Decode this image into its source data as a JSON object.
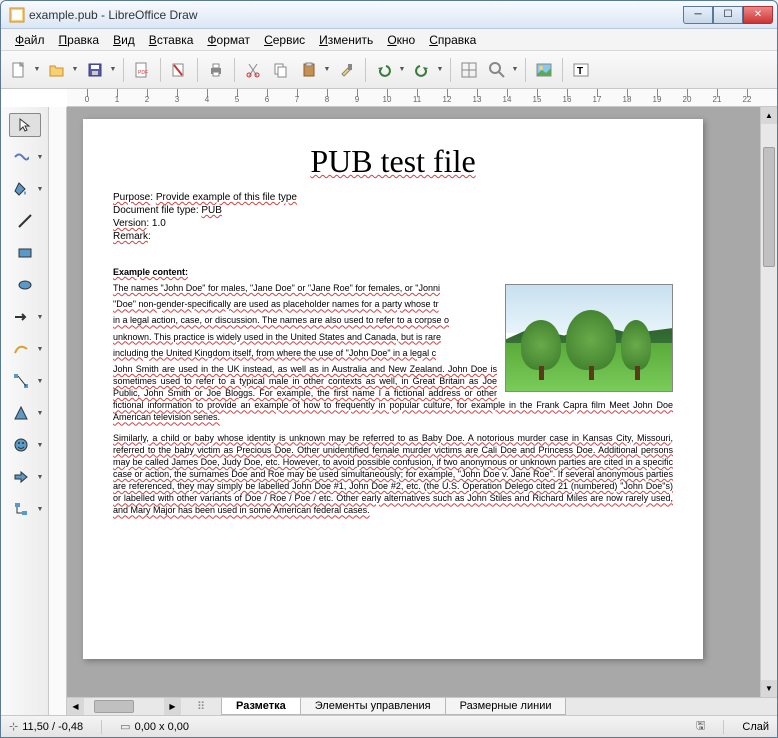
{
  "window": {
    "title": "example.pub - LibreOffice Draw"
  },
  "menu": [
    "Файл",
    "Правка",
    "Вид",
    "Вставка",
    "Формат",
    "Сервис",
    "Изменить",
    "Окно",
    "Справка"
  ],
  "tabs": {
    "active": "Разметка",
    "items": [
      "Разметка",
      "Элементы управления",
      "Размерные линии"
    ]
  },
  "statusbar": {
    "position": "11,50 / -0,48",
    "size": "0,00 x 0,00",
    "mode": "Слай"
  },
  "document": {
    "title": "PUB test file",
    "meta": {
      "purpose_label": "Purpose",
      "purpose": "Provide example of this file type",
      "doctype_label": "Document file type",
      "doctype": "PUB",
      "version_label": "Version",
      "version": "1.0",
      "remark_label": "Remark",
      "remark": ""
    },
    "content_heading": "Example content:",
    "para1": "The names \"John Doe\" for males, \"Jane Doe\" or \"Jane Roe\" for females, or \"Jonni",
    "para2": "\"Doe\" non-gender-specifically are used as placeholder names for a party whose tr",
    "para3": "in a legal action, case, or discussion. The names are also used to refer to a corpse o",
    "para4": "unknown. This practice is widely used in the United States and Canada, but is rare",
    "para5": "including the United Kingdom itself, from where the use of \"John Doe\" in a legal c",
    "para6": "John Smith are used in the UK instead, as well as in Australia and New Zealand. John Doe is sometimes used to refer to a typical male in other contexts as well, in Great Britain as Joe Public, John Smith or Joe Bloggs. For example, the first name l a fictional address or other fictional information to provide an example of how to frequently in popular culture, for example in the Frank Capra film Meet John Doe American television series.",
    "para7": "Similarly, a child or baby whose identity is unknown may be referred to as Baby Doe. A notorious murder case in Kansas City, Missouri, referred to the baby victim as Precious Doe. Other unidentified female murder victims are Cali Doe and Princess Doe. Additional persons may be called James Doe, Judy Doe, etc. However, to avoid possible confusion, if two anonymous or unknown parties are cited in a specific case or action, the surnames Doe and Roe may be used simultaneously; for example, \"John Doe v. Jane Roe\". If several anonymous parties are referenced, they may simply be labelled John Doe #1, John Doe #2, etc. (the U.S. Operation Delego cited 21 (numbered) \"John Doe\"s) or labelled with other variants of Doe / Roe / Poe / etc. Other early alternatives such as John Stiles and Richard Miles are now rarely used, and Mary Major has been used in some American federal cases."
  }
}
